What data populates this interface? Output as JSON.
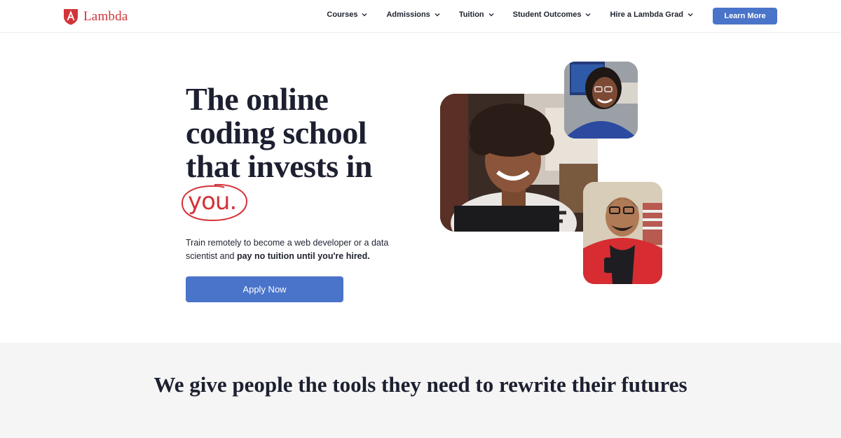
{
  "brand": {
    "name": "Lambda",
    "color": "#d3343a"
  },
  "nav": {
    "items": [
      {
        "label": "Courses"
      },
      {
        "label": "Admissions"
      },
      {
        "label": "Tuition"
      },
      {
        "label": "Student Outcomes"
      },
      {
        "label": "Hire a Lambda Grad"
      }
    ],
    "cta_label": "Learn More"
  },
  "hero": {
    "title": "The online coding school that invests in",
    "title_highlight": "you.",
    "subtitle_plain": "Train remotely to become a web developer or a data scientist and ",
    "subtitle_bold": "pay no tuition until you're hired.",
    "apply_label": "Apply Now"
  },
  "section": {
    "title": "We give people the tools they need to rewrite their futures"
  },
  "colors": {
    "accent": "#4a74c9",
    "brand_red": "#d3343a",
    "band_bg": "#f5f5f5"
  }
}
